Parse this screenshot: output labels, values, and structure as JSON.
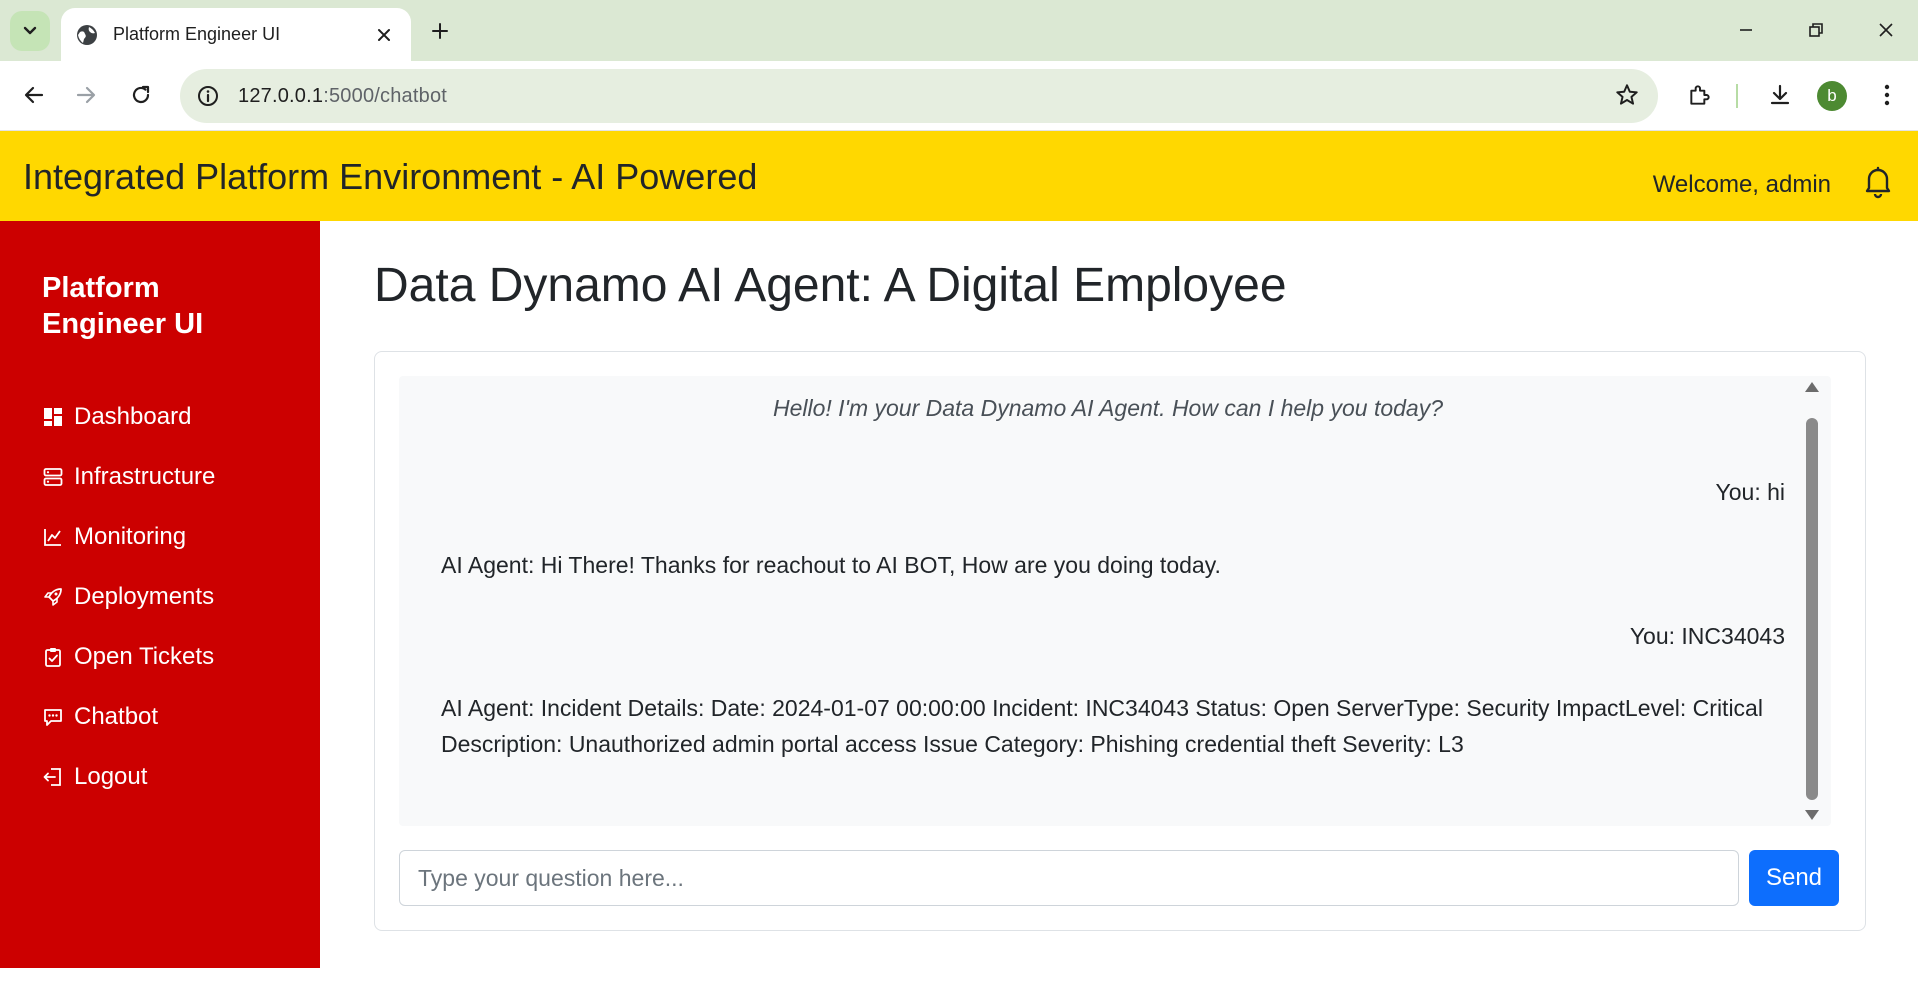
{
  "browser": {
    "tab_title": "Platform Engineer UI",
    "url_host": "127.0.0.1",
    "url_rest": ":5000/chatbot",
    "profile_initial": "b"
  },
  "header": {
    "title": "Integrated Platform Environment - AI Powered",
    "welcome": "Welcome, admin"
  },
  "sidebar": {
    "brand": "Platform Engineer UI",
    "items": [
      {
        "label": "Dashboard",
        "icon": "dashboard-icon"
      },
      {
        "label": "Infrastructure",
        "icon": "server-icon"
      },
      {
        "label": "Monitoring",
        "icon": "chart-line-icon"
      },
      {
        "label": "Deployments",
        "icon": "rocket-icon"
      },
      {
        "label": "Open Tickets",
        "icon": "clipboard-check-icon"
      },
      {
        "label": "Chatbot",
        "icon": "chat-icon"
      },
      {
        "label": "Logout",
        "icon": "logout-icon"
      }
    ]
  },
  "main": {
    "title": "Data Dynamo AI Agent: A Digital Employee",
    "greeting": "Hello! I'm your Data Dynamo AI Agent. How can I help you today?",
    "messages": [
      {
        "role": "user",
        "text": "You: hi"
      },
      {
        "role": "bot",
        "text": "AI Agent: Hi There! Thanks for reachout to AI BOT, How are you doing today."
      },
      {
        "role": "user",
        "text": "You: INC34043"
      },
      {
        "role": "bot",
        "text": "AI Agent: Incident Details: Date: 2024-01-07 00:00:00 Incident: INC34043 Status: Open ServerType: Security ImpactLevel: Critical Description: Unauthorized admin portal access Issue Category: Phishing credential theft Severity: L3"
      }
    ],
    "input_placeholder": "Type your question here...",
    "send_label": "Send"
  },
  "colors": {
    "header_bg": "#ffd800",
    "sidebar_bg": "#cc0000",
    "send_button": "#0d6efd"
  }
}
